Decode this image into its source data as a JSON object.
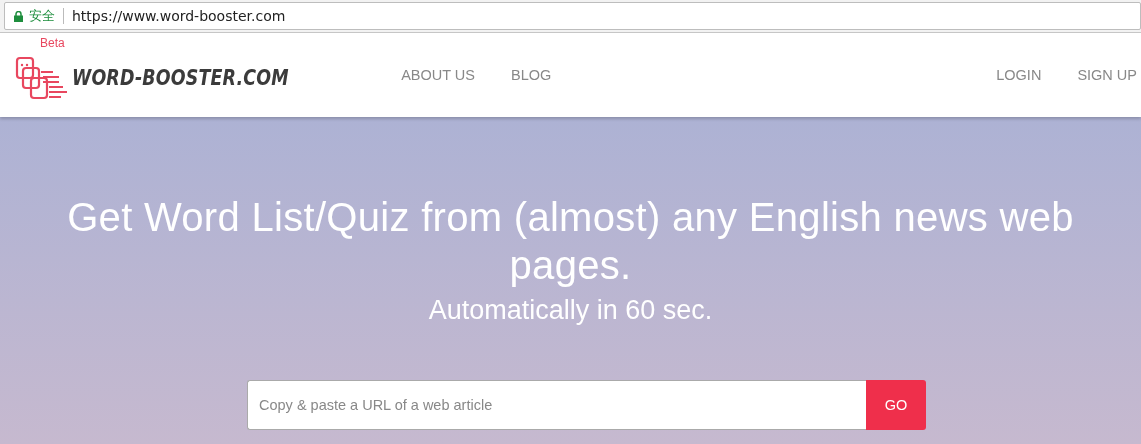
{
  "browser": {
    "security_label": "安全",
    "url": "https://www.word-booster.com"
  },
  "header": {
    "logo": {
      "badge": "Beta",
      "text": "WORD-BOOSTER.COM"
    },
    "nav_left": [
      "ABOUT US",
      "BLOG"
    ],
    "nav_right": [
      "LOGIN",
      "SIGN UP"
    ]
  },
  "hero": {
    "title": "Get Word List/Quiz from (almost) any English news web pages.",
    "subtitle": "Automatically in 60 sec.",
    "search": {
      "placeholder": "Copy & paste a URL of a web article",
      "button": "GO"
    }
  }
}
